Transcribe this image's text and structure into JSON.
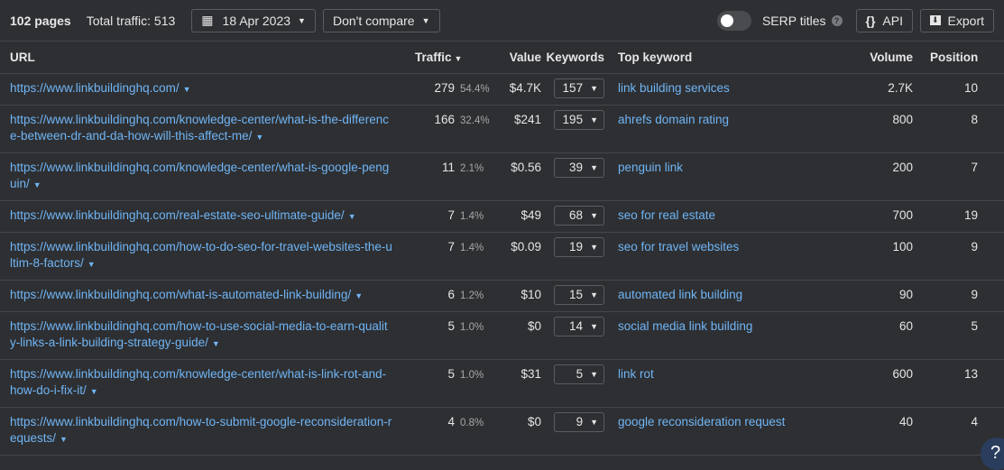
{
  "header": {
    "pages": "102 pages",
    "total_traffic": "Total traffic: 513",
    "date": "18 Apr 2023",
    "compare": "Don't compare",
    "serp_titles": "SERP titles",
    "api": "API",
    "export": "Export"
  },
  "columns": {
    "url": "URL",
    "traffic": "Traffic",
    "value": "Value",
    "keywords": "Keywords",
    "top_keyword": "Top keyword",
    "volume": "Volume",
    "position": "Position"
  },
  "rows": [
    {
      "url": "https://www.linkbuildinghq.com/",
      "traffic": "279",
      "pct": "54.4%",
      "value": "$4.7K",
      "keywords": "157",
      "top_keyword": "link building services",
      "volume": "2.7K",
      "position": "10"
    },
    {
      "url": "https://www.linkbuildinghq.com/knowledge-center/what-is-the-difference-between-dr-and-da-how-will-this-affect-me/",
      "traffic": "166",
      "pct": "32.4%",
      "value": "$241",
      "keywords": "195",
      "top_keyword": "ahrefs domain rating",
      "volume": "800",
      "position": "8"
    },
    {
      "url": "https://www.linkbuildinghq.com/knowledge-center/what-is-google-penguin/",
      "traffic": "11",
      "pct": "2.1%",
      "value": "$0.56",
      "keywords": "39",
      "top_keyword": "penguin link",
      "volume": "200",
      "position": "7"
    },
    {
      "url": "https://www.linkbuildinghq.com/real-estate-seo-ultimate-guide/",
      "traffic": "7",
      "pct": "1.4%",
      "value": "$49",
      "keywords": "68",
      "top_keyword": "seo for real estate",
      "volume": "700",
      "position": "19"
    },
    {
      "url": "https://www.linkbuildinghq.com/how-to-do-seo-for-travel-websites-the-ultim-8-factors/",
      "traffic": "7",
      "pct": "1.4%",
      "value": "$0.09",
      "keywords": "19",
      "top_keyword": "seo for travel websites",
      "volume": "100",
      "position": "9"
    },
    {
      "url": "https://www.linkbuildinghq.com/what-is-automated-link-building/",
      "traffic": "6",
      "pct": "1.2%",
      "value": "$10",
      "keywords": "15",
      "top_keyword": "automated link building",
      "volume": "90",
      "position": "9"
    },
    {
      "url": "https://www.linkbuildinghq.com/how-to-use-social-media-to-earn-quality-links-a-link-building-strategy-guide/",
      "traffic": "5",
      "pct": "1.0%",
      "value": "$0",
      "keywords": "14",
      "top_keyword": "social media link building",
      "volume": "60",
      "position": "5"
    },
    {
      "url": "https://www.linkbuildinghq.com/knowledge-center/what-is-link-rot-and-how-do-i-fix-it/",
      "traffic": "5",
      "pct": "1.0%",
      "value": "$31",
      "keywords": "5",
      "top_keyword": "link rot",
      "volume": "600",
      "position": "13"
    },
    {
      "url": "https://www.linkbuildinghq.com/how-to-submit-google-reconsideration-requests/",
      "traffic": "4",
      "pct": "0.8%",
      "value": "$0",
      "keywords": "9",
      "top_keyword": "google reconsideration request",
      "volume": "40",
      "position": "4"
    }
  ],
  "help": "?"
}
